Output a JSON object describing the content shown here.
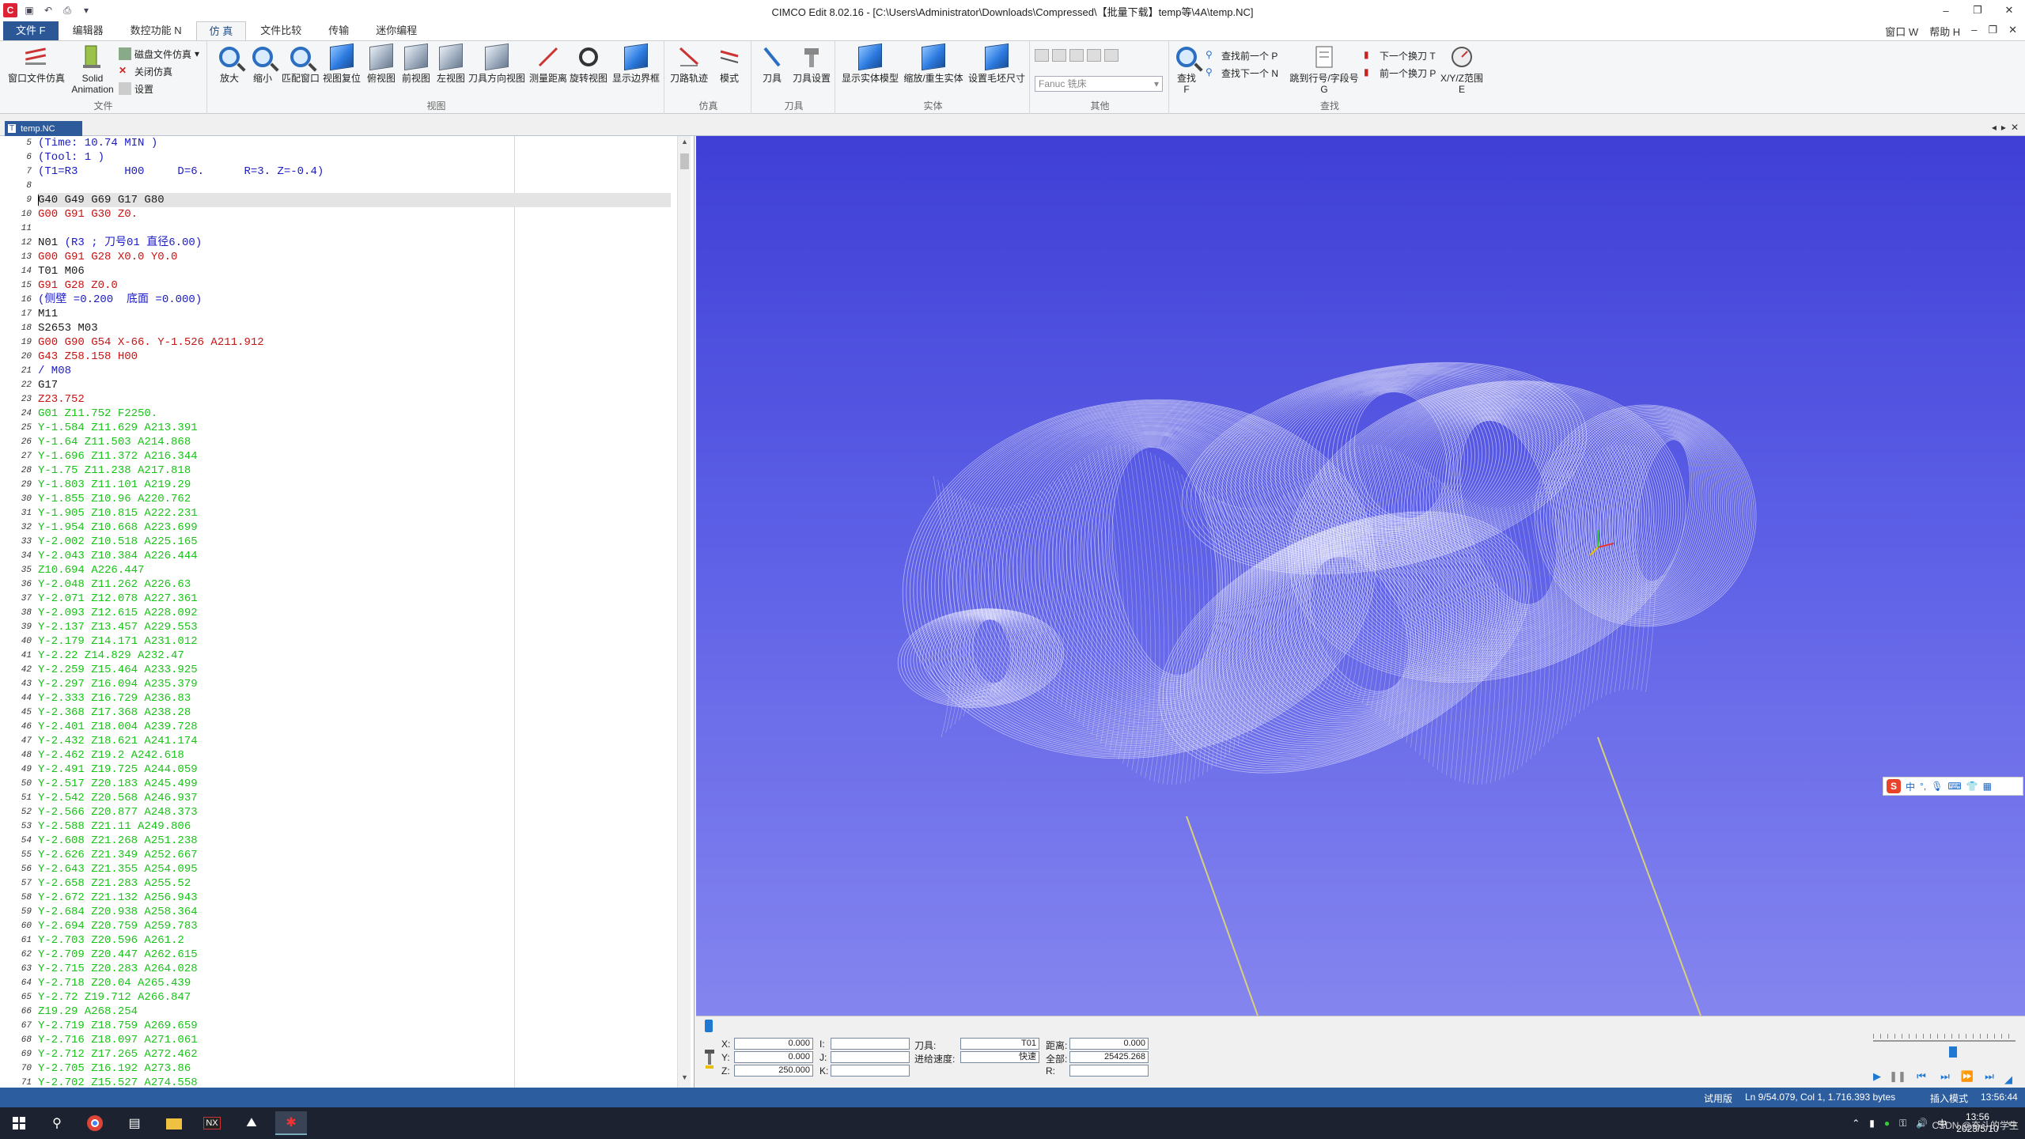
{
  "window": {
    "title": "CIMCO Edit 8.02.16 - [C:\\Users\\Administrator\\Downloads\\Compressed\\【批量下载】temp等\\4A\\temp.NC]",
    "controls": [
      "–",
      "❐",
      "✕"
    ]
  },
  "ribbon_tabs": [
    "文件 F",
    "编辑器",
    "数控功能 N",
    "仿 真",
    "文件比较",
    "传输",
    "迷你编程"
  ],
  "ribbon_right": [
    "窗口 W",
    "帮助 H",
    "–",
    "❐",
    "✕"
  ],
  "ribbon": {
    "file_group": {
      "label": "文件",
      "window_file_sim": "窗口文件仿真",
      "solid_animation": "Solid\nAnimation",
      "disk_file_sim": "磁盘文件仿真",
      "close_sim": "关闭仿真",
      "settings": "设置"
    },
    "view_group": {
      "label": "视图",
      "buttons": [
        "放大",
        "缩小",
        "匹配窗口",
        "视图复位",
        "俯视图",
        "前视图",
        "左视图",
        "刀具方向视图",
        "测量距离",
        "旋转视图",
        "显示边界框"
      ]
    },
    "sim_group": {
      "label": "仿真",
      "buttons": [
        "刀路轨迹",
        "模式"
      ]
    },
    "tool_group": {
      "label": "刀具",
      "buttons": [
        "刀具",
        "刀具设置"
      ]
    },
    "solid_group": {
      "label": "实体",
      "buttons": [
        "显示实体模型",
        "缩放/重生实体",
        "设置毛坯尺寸"
      ]
    },
    "other_group": {
      "label": "其他",
      "machine_select": "Fanuc 铣床"
    },
    "find_group": {
      "label": "查找",
      "find": "查找\nF",
      "find_prev": "查找前一个 P",
      "find_next": "查找下一个 N",
      "goto_line": "跳到行号/字段号\nG",
      "next_tool_change": "下一个换刀 T",
      "prev_tool_change": "前一个换刀 P",
      "xyz_range": "X/Y/Z范围\nE"
    }
  },
  "doc_tab": {
    "label": "temp.NC",
    "icon_text": "T"
  },
  "editor": {
    "lines": [
      {
        "n": "5",
        "t": "(Time: 10.74 MIN )",
        "c": "blue"
      },
      {
        "n": "6",
        "t": "(Tool: 1 )",
        "c": "blue"
      },
      {
        "n": "7",
        "t": "(T1=R3       H00     D=6.      R=3. Z=-0.4)",
        "c": "blue"
      },
      {
        "n": "8",
        "t": "",
        "c": "black"
      },
      {
        "n": "9",
        "t": "G40 G49 G69 G17 G80",
        "c": "black",
        "current": true
      },
      {
        "n": "10",
        "t": "G00 G91 G30 Z0.",
        "c": "red"
      },
      {
        "n": "11",
        "t": "",
        "c": "black"
      },
      {
        "n": "12",
        "t": "N01 (R3 ; 刀号01 直径6.00)",
        "c": "mixed"
      },
      {
        "n": "13",
        "t": "G00 G91 G28 X0.0 Y0.0",
        "c": "red"
      },
      {
        "n": "14",
        "t": "T01 M06",
        "c": "black"
      },
      {
        "n": "15",
        "t": "G91 G28 Z0.0",
        "c": "red"
      },
      {
        "n": "16",
        "t": "(侧壁 =0.200  底面 =0.000)",
        "c": "blue"
      },
      {
        "n": "17",
        "t": "M11",
        "c": "black"
      },
      {
        "n": "18",
        "t": "S2653 M03",
        "c": "black"
      },
      {
        "n": "19",
        "t": "G00 G90 G54 X-66. Y-1.526 A211.912",
        "c": "red"
      },
      {
        "n": "20",
        "t": "G43 Z58.158 H00",
        "c": "red"
      },
      {
        "n": "21",
        "t": "/ M08",
        "c": "blue"
      },
      {
        "n": "22",
        "t": "G17",
        "c": "black"
      },
      {
        "n": "23",
        "t": "Z23.752",
        "c": "red"
      },
      {
        "n": "24",
        "t": "G01 Z11.752 F2250.",
        "c": "green"
      },
      {
        "n": "25",
        "t": "Y-1.584 Z11.629 A213.391",
        "c": "green"
      },
      {
        "n": "26",
        "t": "Y-1.64 Z11.503 A214.868",
        "c": "green"
      },
      {
        "n": "27",
        "t": "Y-1.696 Z11.372 A216.344",
        "c": "green"
      },
      {
        "n": "28",
        "t": "Y-1.75 Z11.238 A217.818",
        "c": "green"
      },
      {
        "n": "29",
        "t": "Y-1.803 Z11.101 A219.29",
        "c": "green"
      },
      {
        "n": "30",
        "t": "Y-1.855 Z10.96 A220.762",
        "c": "green"
      },
      {
        "n": "31",
        "t": "Y-1.905 Z10.815 A222.231",
        "c": "green"
      },
      {
        "n": "32",
        "t": "Y-1.954 Z10.668 A223.699",
        "c": "green"
      },
      {
        "n": "33",
        "t": "Y-2.002 Z10.518 A225.165",
        "c": "green"
      },
      {
        "n": "34",
        "t": "Y-2.043 Z10.384 A226.444",
        "c": "green"
      },
      {
        "n": "35",
        "t": "Z10.694 A226.447",
        "c": "green"
      },
      {
        "n": "36",
        "t": "Y-2.048 Z11.262 A226.63",
        "c": "green"
      },
      {
        "n": "37",
        "t": "Y-2.071 Z12.078 A227.361",
        "c": "green"
      },
      {
        "n": "38",
        "t": "Y-2.093 Z12.615 A228.092",
        "c": "green"
      },
      {
        "n": "39",
        "t": "Y-2.137 Z13.457 A229.553",
        "c": "green"
      },
      {
        "n": "40",
        "t": "Y-2.179 Z14.171 A231.012",
        "c": "green"
      },
      {
        "n": "41",
        "t": "Y-2.22 Z14.829 A232.47",
        "c": "green"
      },
      {
        "n": "42",
        "t": "Y-2.259 Z15.464 A233.925",
        "c": "green"
      },
      {
        "n": "43",
        "t": "Y-2.297 Z16.094 A235.379",
        "c": "green"
      },
      {
        "n": "44",
        "t": "Y-2.333 Z16.729 A236.83",
        "c": "green"
      },
      {
        "n": "45",
        "t": "Y-2.368 Z17.368 A238.28",
        "c": "green"
      },
      {
        "n": "46",
        "t": "Y-2.401 Z18.004 A239.728",
        "c": "green"
      },
      {
        "n": "47",
        "t": "Y-2.432 Z18.621 A241.174",
        "c": "green"
      },
      {
        "n": "48",
        "t": "Y-2.462 Z19.2 A242.618",
        "c": "green"
      },
      {
        "n": "49",
        "t": "Y-2.491 Z19.725 A244.059",
        "c": "green"
      },
      {
        "n": "50",
        "t": "Y-2.517 Z20.183 A245.499",
        "c": "green"
      },
      {
        "n": "51",
        "t": "Y-2.542 Z20.568 A246.937",
        "c": "green"
      },
      {
        "n": "52",
        "t": "Y-2.566 Z20.877 A248.373",
        "c": "green"
      },
      {
        "n": "53",
        "t": "Y-2.588 Z21.11 A249.806",
        "c": "green"
      },
      {
        "n": "54",
        "t": "Y-2.608 Z21.268 A251.238",
        "c": "green"
      },
      {
        "n": "55",
        "t": "Y-2.626 Z21.349 A252.667",
        "c": "green"
      },
      {
        "n": "56",
        "t": "Y-2.643 Z21.355 A254.095",
        "c": "green"
      },
      {
        "n": "57",
        "t": "Y-2.658 Z21.283 A255.52",
        "c": "green"
      },
      {
        "n": "58",
        "t": "Y-2.672 Z21.132 A256.943",
        "c": "green"
      },
      {
        "n": "59",
        "t": "Y-2.684 Z20.938 A258.364",
        "c": "green"
      },
      {
        "n": "60",
        "t": "Y-2.694 Z20.759 A259.783",
        "c": "green"
      },
      {
        "n": "61",
        "t": "Y-2.703 Z20.596 A261.2",
        "c": "green"
      },
      {
        "n": "62",
        "t": "Y-2.709 Z20.447 A262.615",
        "c": "green"
      },
      {
        "n": "63",
        "t": "Y-2.715 Z20.283 A264.028",
        "c": "green"
      },
      {
        "n": "64",
        "t": "Y-2.718 Z20.04 A265.439",
        "c": "green"
      },
      {
        "n": "65",
        "t": "Y-2.72 Z19.712 A266.847",
        "c": "green"
      },
      {
        "n": "66",
        "t": "Z19.29 A268.254",
        "c": "green"
      },
      {
        "n": "67",
        "t": "Y-2.719 Z18.759 A269.659",
        "c": "green"
      },
      {
        "n": "68",
        "t": "Y-2.716 Z18.097 A271.061",
        "c": "green"
      },
      {
        "n": "69",
        "t": "Y-2.712 Z17.265 A272.462",
        "c": "green"
      },
      {
        "n": "70",
        "t": "Y-2.705 Z16.192 A273.86",
        "c": "green"
      },
      {
        "n": "71",
        "t": "Y-2.702 Z15.527 A274.558",
        "c": "green"
      }
    ],
    "line12_parts": [
      {
        "t": "N01 ",
        "c": "black"
      },
      {
        "t": "(R3 ; 刀号01 直径6.00)",
        "c": "blue"
      }
    ]
  },
  "colors": {
    "black": "#1a1a1a",
    "blue": "#1b1bc4",
    "red": "#c81414",
    "green": "#17c417",
    "ribbon_accent": "#2b5797",
    "viewport_top": "#3f3fd6",
    "viewport_bottom": "#8585ef"
  },
  "sim_panel": {
    "x_label": "X:",
    "x_value": "0.000",
    "y_label": "Y:",
    "y_value": "0.000",
    "z_label": "Z:",
    "z_value": "250.000",
    "i_label": "I:",
    "j_label": "J:",
    "k_label": "K:",
    "i_value": "",
    "j_value": "",
    "k_value": "",
    "tool_label": "刀具:",
    "tool_value": "T01",
    "feed_label": "进给速度:",
    "feed_value": "快速",
    "dist_label": "距离:",
    "dist_value": "0.000",
    "total_label": "全部:",
    "total_value": "25425.268",
    "r_label": "R:",
    "r_value": ""
  },
  "status_bar": {
    "mode": "试用版",
    "position": "Ln 9/54.079, Col 1, 1.716.393 bytes",
    "insert_mode": "插入模式",
    "time": "13:56:44"
  },
  "taskbar": {
    "clock_time": "13:56",
    "clock_date": "2023/5/10"
  },
  "ime": {
    "label": "中"
  },
  "watermark": "CSDN @奋斗的学生"
}
